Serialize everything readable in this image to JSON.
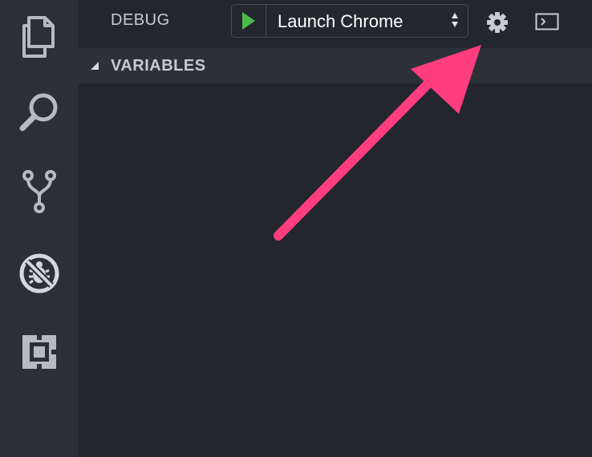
{
  "activity_bar": {
    "items": [
      {
        "icon": "files-icon"
      },
      {
        "icon": "search-icon"
      },
      {
        "icon": "source-control-icon"
      },
      {
        "icon": "debug-icon"
      },
      {
        "icon": "extensions-icon"
      }
    ]
  },
  "debug": {
    "title": "DEBUG",
    "launch_config": "Launch Chrome",
    "play_icon": "play-icon",
    "gear_icon": "gear-icon",
    "console_icon": "console-icon"
  },
  "variables": {
    "title": "VARIABLES"
  },
  "colors": {
    "activity_bar_bg": "#2d2f38",
    "sidebar_bg": "#24262d",
    "section_header_bg": "#2e3038",
    "play_green": "#4cbb4c",
    "arrow_pink": "#ff3d7f",
    "icon_gray": "#b7bac0"
  }
}
